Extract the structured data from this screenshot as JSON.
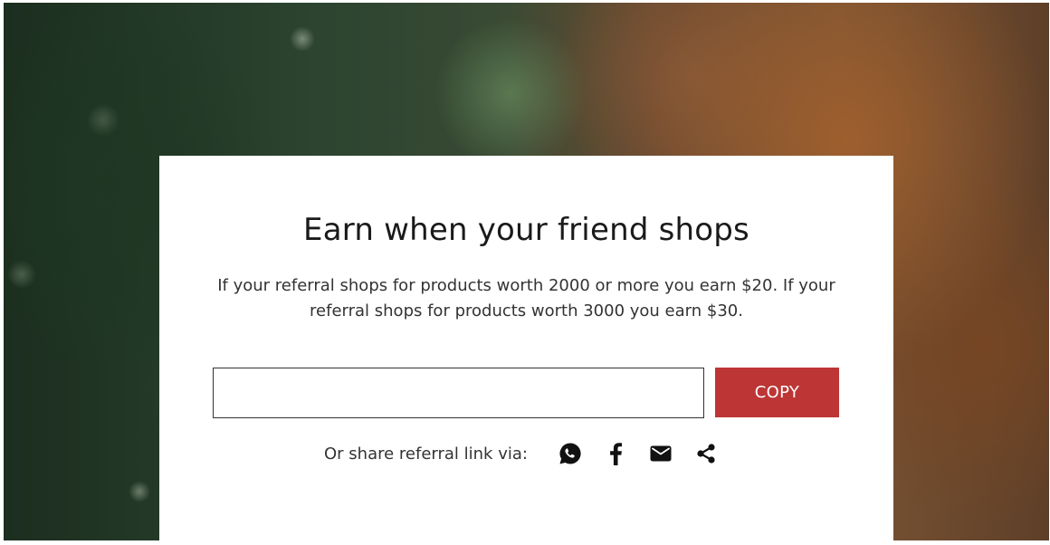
{
  "card": {
    "title": "Earn when your friend shops",
    "description": "If your referral shops for products worth 2000 or more you earn $20. If your referral shops for products worth 3000 you earn $30."
  },
  "referral": {
    "link_value": "",
    "copy_label": "COPY"
  },
  "share": {
    "label": "Or share referral link via:",
    "icons": [
      "whatsapp-icon",
      "facebook-icon",
      "email-icon",
      "share-icon"
    ]
  },
  "colors": {
    "accent": "#bd3535",
    "text": "#1a1a1a",
    "card_bg": "#ffffff"
  }
}
